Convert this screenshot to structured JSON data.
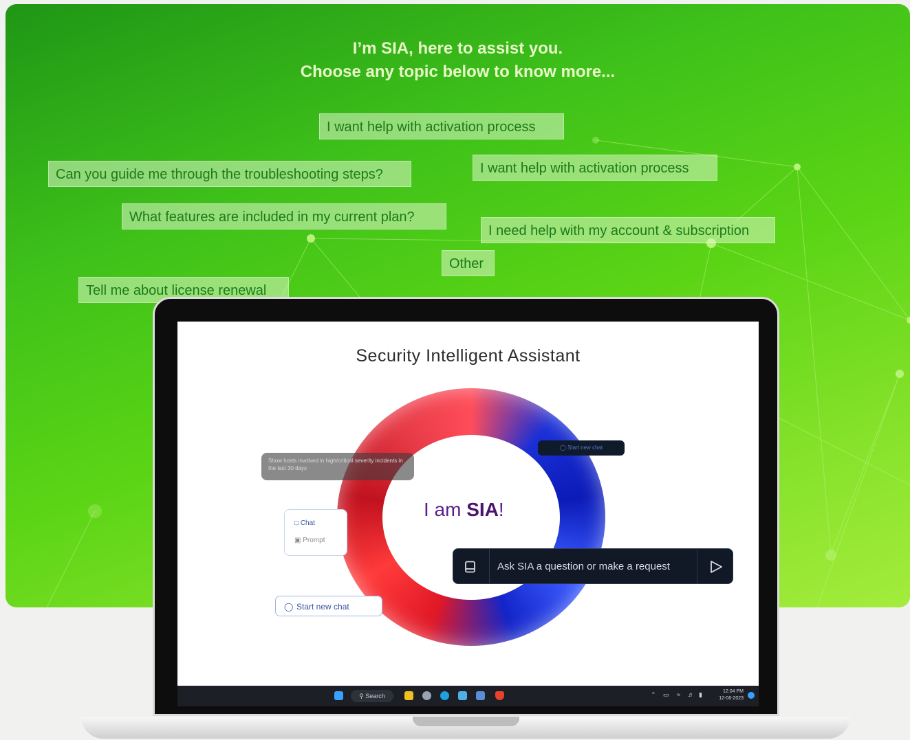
{
  "header": {
    "line1": "I’m SIA, here to assist you.",
    "line2": "Choose any topic below to know more..."
  },
  "topics": [
    "I want help with activation process",
    "Can you guide me through the troubleshooting steps?",
    "I want help with activation process",
    "What features are included in my current plan?",
    "I need help with my account & subscription",
    "Other",
    "Tell me about license renewal"
  ],
  "screen": {
    "title": "Security Intelligent Assistant",
    "greeting_prefix": "I am ",
    "greeting_name": "SIA",
    "greeting_suffix": "!",
    "bubble_text": "Show hosts involved in high/critical severity incidents in the last 30 days",
    "start_new_chat_small": "Start new chat",
    "side_chat": "Chat",
    "side_prompt": "Prompt",
    "start_new_chat": "Start new chat",
    "ask_placeholder": "Ask SIA a question or make a request"
  },
  "taskbar": {
    "search_label": "Search",
    "time": "12:04 PM",
    "date": "12-06-2023"
  },
  "colors": {
    "brand_green": "#3fc11a",
    "chip_text": "#1d7a1a",
    "sia_purple": "#5a1e8c"
  }
}
